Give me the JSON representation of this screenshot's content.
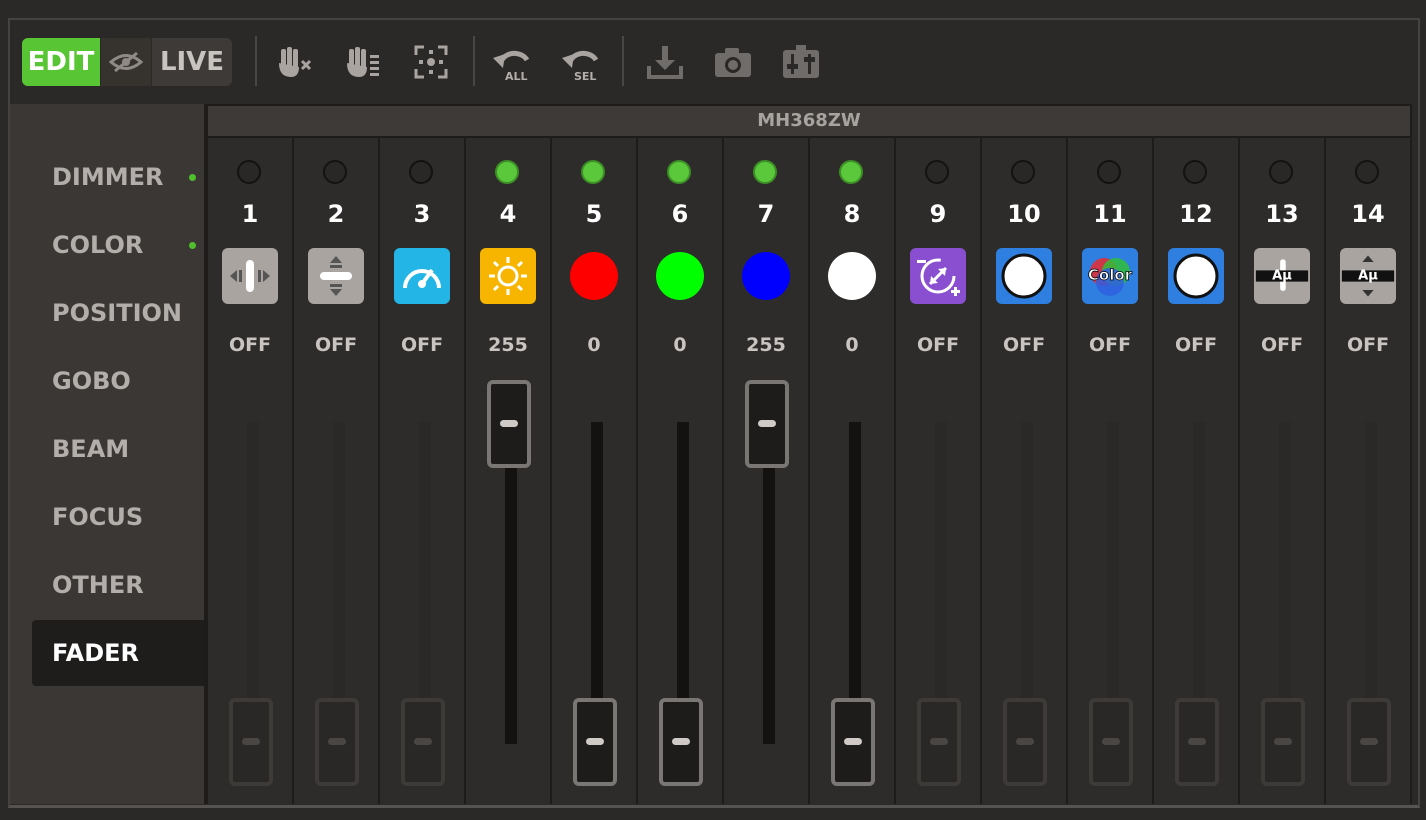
{
  "toolbar": {
    "modes": {
      "edit": "EDIT",
      "live": "LIVE"
    },
    "undo_all_label": "ALL",
    "undo_sel_label": "SEL",
    "accent_color": "#58c634",
    "icons": [
      "hide-icon",
      "hand-clear-icon",
      "hand-highlight-icon",
      "select-fixture-icon",
      "undo-all-icon",
      "undo-selected-icon",
      "store-icon",
      "snapshot-camera-icon",
      "fader-settings-icon"
    ]
  },
  "sidebar": {
    "items": [
      {
        "label": "DIMMER",
        "has_values": true
      },
      {
        "label": "COLOR",
        "has_values": true
      },
      {
        "label": "POSITION",
        "has_values": false
      },
      {
        "label": "GOBO",
        "has_values": false
      },
      {
        "label": "BEAM",
        "has_values": false
      },
      {
        "label": "FOCUS",
        "has_values": false
      },
      {
        "label": "OTHER",
        "has_values": false
      },
      {
        "label": "FADER",
        "has_values": false,
        "active": true
      }
    ]
  },
  "fixture": {
    "name": "MH368ZW"
  },
  "channels": [
    {
      "number": "1",
      "value": "OFF",
      "led_on": false,
      "icon": "pan-fine-icon",
      "fader": null
    },
    {
      "number": "2",
      "value": "OFF",
      "led_on": false,
      "icon": "tilt-fine-icon",
      "fader": null
    },
    {
      "number": "3",
      "value": "OFF",
      "led_on": false,
      "icon": "speed-icon",
      "fader": null
    },
    {
      "number": "4",
      "value": "255",
      "led_on": true,
      "icon": "intensity-icon",
      "fader": 255
    },
    {
      "number": "5",
      "value": "0",
      "led_on": true,
      "icon": "red-color-icon",
      "fader": 0
    },
    {
      "number": "6",
      "value": "0",
      "led_on": true,
      "icon": "green-color-icon",
      "fader": 0
    },
    {
      "number": "7",
      "value": "255",
      "led_on": true,
      "icon": "blue-color-icon",
      "fader": 255
    },
    {
      "number": "8",
      "value": "0",
      "led_on": true,
      "icon": "white-color-icon",
      "fader": 0
    },
    {
      "number": "9",
      "value": "OFF",
      "led_on": false,
      "icon": "zoom-icon",
      "fader": null
    },
    {
      "number": "10",
      "value": "OFF",
      "led_on": false,
      "icon": "color-wheel-icon",
      "fader": null
    },
    {
      "number": "11",
      "value": "OFF",
      "led_on": false,
      "icon": "color-macro-icon",
      "icon_text": "Color",
      "fader": null
    },
    {
      "number": "12",
      "value": "OFF",
      "led_on": false,
      "icon": "color-wheel-2-icon",
      "fader": null
    },
    {
      "number": "13",
      "value": "OFF",
      "led_on": false,
      "icon": "auto-program-icon",
      "icon_text": "Aμ",
      "fader": null
    },
    {
      "number": "14",
      "value": "OFF",
      "led_on": false,
      "icon": "auto-program-speed-icon",
      "icon_text": "Aμ",
      "fader": null
    }
  ],
  "colors": {
    "led_on": "#5ac83a",
    "red": "#ff0000",
    "green": "#00ff00",
    "blue": "#0000ff",
    "white": "#ffffff",
    "speed": "#22b5e6",
    "intensity": "#f7b500",
    "zoom": "#8a4fd0",
    "wheel": "#2f7fe0"
  }
}
